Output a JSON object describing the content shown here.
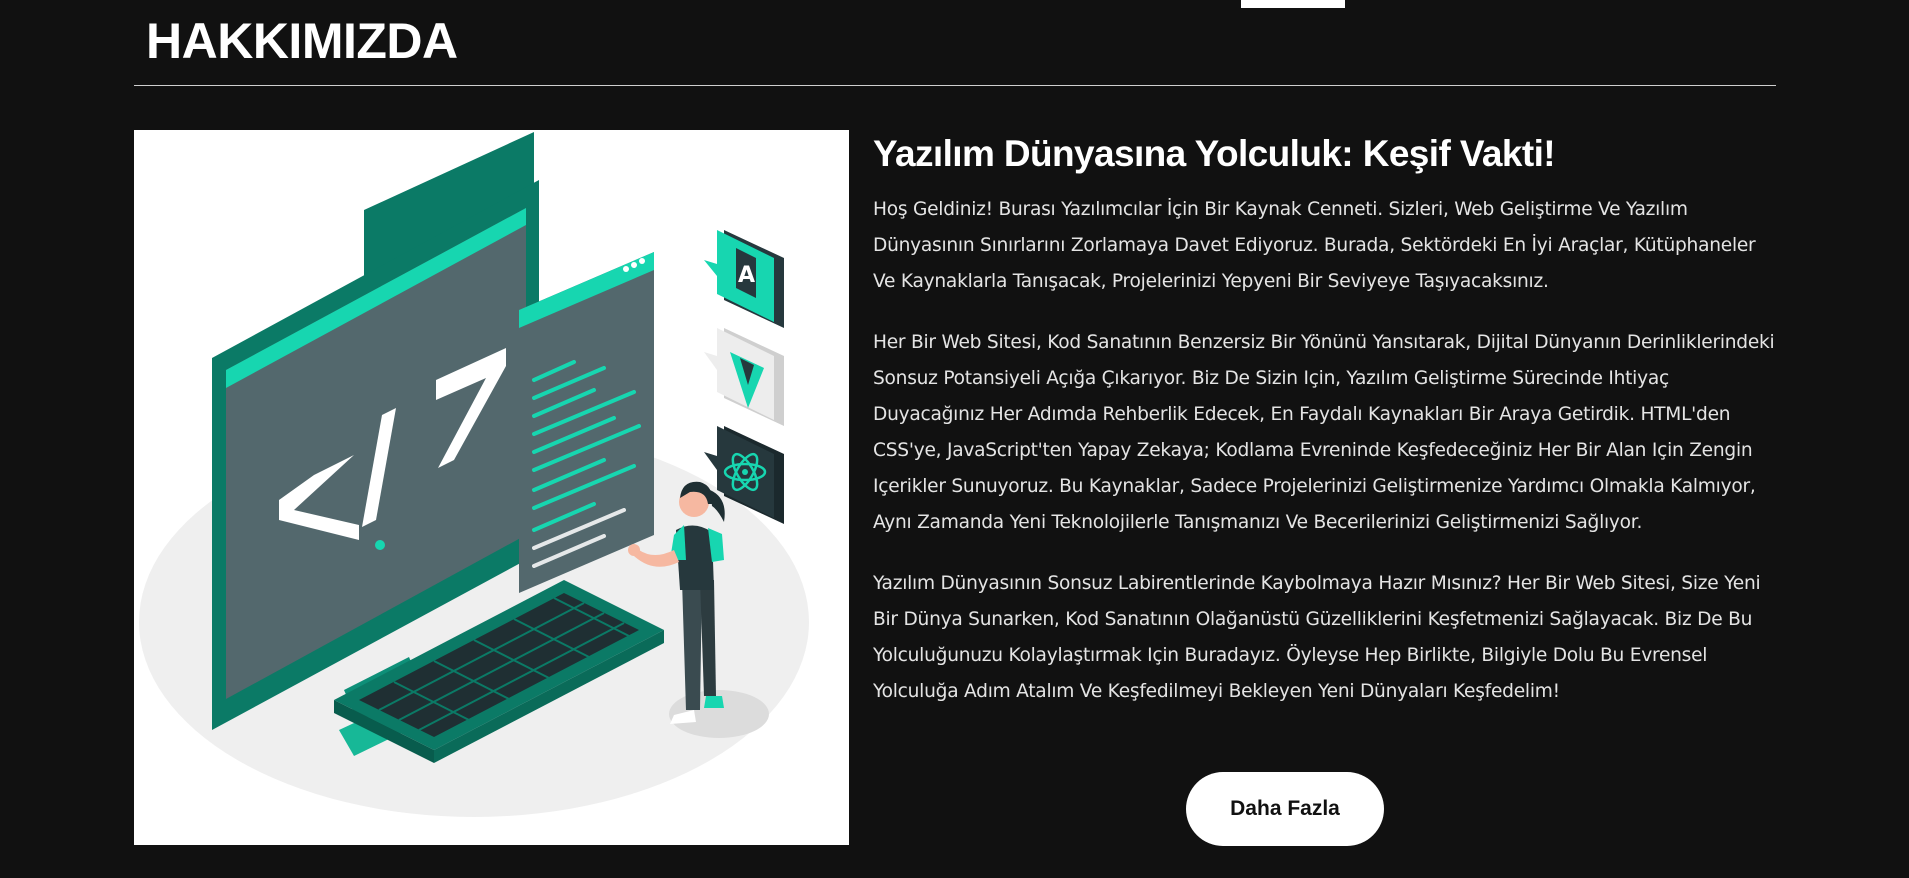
{
  "section": {
    "title": "HAKKIMIZDA"
  },
  "about": {
    "headline": "Yazılım Dünyasına Yolculuk: Keşif Vakti!",
    "paragraphs": [
      "Hoş Geldiniz! Burası Yazılımcılar İçin Bir Kaynak Cenneti. Sizleri, Web Geliştirme Ve Yazılım Dünyasının Sınırlarını Zorlamaya Davet Ediyoruz. Burada, Sektördeki En İyi Araçlar, Kütüphaneler Ve Kaynaklarla Tanışacak, Projelerinizi Yepyeni Bir Seviyeye Taşıyacaksınız.",
      "Her Bir Web Sitesi, Kod Sanatının Benzersiz Bir Yönünü Yansıtarak, Dijital Dünyanın Derinliklerindeki Sonsuz Potansiyeli Açığa Çıkarıyor. Biz De Sizin Için, Yazılım Geliştirme Sürecinde Ihtiyaç Duyacağınız Her Adımda Rehberlik Edecek, En Faydalı Kaynakları Bir Araya Getirdik. HTML'den CSS'ye, JavaScript'ten Yapay Zekaya; Kodlama Evreninde Keşfedeceğiniz Her Bir Alan Için Zengin Içerikler Sunuyoruz. Bu Kaynaklar, Sadece Projelerinizi Geliştirmenize Yardımcı Olmakla Kalmıyor, Aynı Zamanda Yeni Teknolojilerle Tanışmanızı Ve Becerilerinizi Geliştirmenizi Sağlıyor.",
      "Yazılım Dünyasının Sonsuz Labirentlerinde Kaybolmaya Hazır Mısınız? Her Bir Web Sitesi, Size Yeni Bir Dünya Sunarken, Kod Sanatının Olağanüstü Güzelliklerini Keşfetmenizi Sağlayacak. Biz De Bu Yolculuğunuzu Kolaylaştırmak Için Buradayız. Öyleyse Hep Birlikte, Bilgiyle Dolu Bu Evrensel Yolculuğa Adım Atalım Ve Keşfedilmeyi Bekleyen Yeni Dünyaları Keşfedelim!"
    ],
    "button_label": "Daha Fazla"
  },
  "illustration": {
    "code_symbol": "</>",
    "badges": [
      "angular-icon",
      "vue-icon",
      "react-icon"
    ],
    "colors": {
      "accent": "#17d6b0",
      "dark_teal": "#0b7a66",
      "screen": "#53686d",
      "badge_dark": "#26383d"
    }
  }
}
